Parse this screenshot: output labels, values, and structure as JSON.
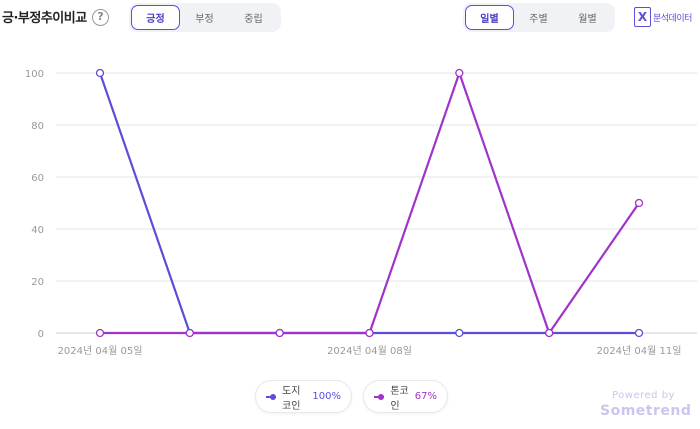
{
  "header": {
    "title": "긍·부정추이비교",
    "help": "?",
    "sentiment_tabs": [
      {
        "label": "긍정",
        "active": true
      },
      {
        "label": "부정",
        "active": false
      },
      {
        "label": "중립",
        "active": false
      }
    ],
    "period_tabs": [
      {
        "label": "일별",
        "active": true
      },
      {
        "label": "주별",
        "active": false
      },
      {
        "label": "월별",
        "active": false
      }
    ],
    "export_label": "분석데이터",
    "export_icon": "excel-icon"
  },
  "chart_data": {
    "type": "line",
    "x": [
      "2024-04-05",
      "2024-04-06",
      "2024-04-07",
      "2024-04-08",
      "2024-04-09",
      "2024-04-10",
      "2024-04-11"
    ],
    "x_tick_labels": [
      "2024년 04월 05일",
      "2024년 04월 08일",
      "2024년 04월 11일"
    ],
    "y_ticks": [
      0,
      20,
      40,
      60,
      80,
      100
    ],
    "ylim": [
      0,
      100
    ],
    "grid": true,
    "series": [
      {
        "name": "도지코인",
        "color": "#5b4ed8",
        "values": [
          100,
          0,
          0,
          0,
          0,
          0,
          0
        ]
      },
      {
        "name": "톤코인",
        "color": "#a033c9",
        "values": [
          0,
          0,
          0,
          0,
          100,
          0,
          50
        ]
      }
    ]
  },
  "legend": [
    {
      "name": "도지코인",
      "pct": "100%"
    },
    {
      "name": "톤코인",
      "pct": "67%"
    }
  ],
  "footer": {
    "powered_by": "Powered by",
    "brand": "Sometrend"
  }
}
